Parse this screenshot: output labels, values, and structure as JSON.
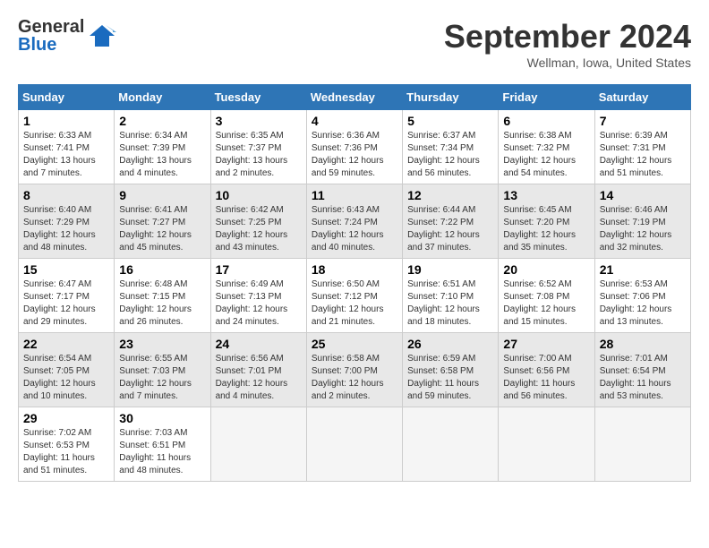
{
  "header": {
    "logo_line1": "General",
    "logo_line2": "Blue",
    "month": "September 2024",
    "location": "Wellman, Iowa, United States"
  },
  "columns": [
    "Sunday",
    "Monday",
    "Tuesday",
    "Wednesday",
    "Thursday",
    "Friday",
    "Saturday"
  ],
  "weeks": [
    [
      {
        "day": "1",
        "sunrise": "Sunrise: 6:33 AM",
        "sunset": "Sunset: 7:41 PM",
        "daylight": "Daylight: 13 hours and 7 minutes."
      },
      {
        "day": "2",
        "sunrise": "Sunrise: 6:34 AM",
        "sunset": "Sunset: 7:39 PM",
        "daylight": "Daylight: 13 hours and 4 minutes."
      },
      {
        "day": "3",
        "sunrise": "Sunrise: 6:35 AM",
        "sunset": "Sunset: 7:37 PM",
        "daylight": "Daylight: 13 hours and 2 minutes."
      },
      {
        "day": "4",
        "sunrise": "Sunrise: 6:36 AM",
        "sunset": "Sunset: 7:36 PM",
        "daylight": "Daylight: 12 hours and 59 minutes."
      },
      {
        "day": "5",
        "sunrise": "Sunrise: 6:37 AM",
        "sunset": "Sunset: 7:34 PM",
        "daylight": "Daylight: 12 hours and 56 minutes."
      },
      {
        "day": "6",
        "sunrise": "Sunrise: 6:38 AM",
        "sunset": "Sunset: 7:32 PM",
        "daylight": "Daylight: 12 hours and 54 minutes."
      },
      {
        "day": "7",
        "sunrise": "Sunrise: 6:39 AM",
        "sunset": "Sunset: 7:31 PM",
        "daylight": "Daylight: 12 hours and 51 minutes."
      }
    ],
    [
      {
        "day": "8",
        "sunrise": "Sunrise: 6:40 AM",
        "sunset": "Sunset: 7:29 PM",
        "daylight": "Daylight: 12 hours and 48 minutes."
      },
      {
        "day": "9",
        "sunrise": "Sunrise: 6:41 AM",
        "sunset": "Sunset: 7:27 PM",
        "daylight": "Daylight: 12 hours and 45 minutes."
      },
      {
        "day": "10",
        "sunrise": "Sunrise: 6:42 AM",
        "sunset": "Sunset: 7:25 PM",
        "daylight": "Daylight: 12 hours and 43 minutes."
      },
      {
        "day": "11",
        "sunrise": "Sunrise: 6:43 AM",
        "sunset": "Sunset: 7:24 PM",
        "daylight": "Daylight: 12 hours and 40 minutes."
      },
      {
        "day": "12",
        "sunrise": "Sunrise: 6:44 AM",
        "sunset": "Sunset: 7:22 PM",
        "daylight": "Daylight: 12 hours and 37 minutes."
      },
      {
        "day": "13",
        "sunrise": "Sunrise: 6:45 AM",
        "sunset": "Sunset: 7:20 PM",
        "daylight": "Daylight: 12 hours and 35 minutes."
      },
      {
        "day": "14",
        "sunrise": "Sunrise: 6:46 AM",
        "sunset": "Sunset: 7:19 PM",
        "daylight": "Daylight: 12 hours and 32 minutes."
      }
    ],
    [
      {
        "day": "15",
        "sunrise": "Sunrise: 6:47 AM",
        "sunset": "Sunset: 7:17 PM",
        "daylight": "Daylight: 12 hours and 29 minutes."
      },
      {
        "day": "16",
        "sunrise": "Sunrise: 6:48 AM",
        "sunset": "Sunset: 7:15 PM",
        "daylight": "Daylight: 12 hours and 26 minutes."
      },
      {
        "day": "17",
        "sunrise": "Sunrise: 6:49 AM",
        "sunset": "Sunset: 7:13 PM",
        "daylight": "Daylight: 12 hours and 24 minutes."
      },
      {
        "day": "18",
        "sunrise": "Sunrise: 6:50 AM",
        "sunset": "Sunset: 7:12 PM",
        "daylight": "Daylight: 12 hours and 21 minutes."
      },
      {
        "day": "19",
        "sunrise": "Sunrise: 6:51 AM",
        "sunset": "Sunset: 7:10 PM",
        "daylight": "Daylight: 12 hours and 18 minutes."
      },
      {
        "day": "20",
        "sunrise": "Sunrise: 6:52 AM",
        "sunset": "Sunset: 7:08 PM",
        "daylight": "Daylight: 12 hours and 15 minutes."
      },
      {
        "day": "21",
        "sunrise": "Sunrise: 6:53 AM",
        "sunset": "Sunset: 7:06 PM",
        "daylight": "Daylight: 12 hours and 13 minutes."
      }
    ],
    [
      {
        "day": "22",
        "sunrise": "Sunrise: 6:54 AM",
        "sunset": "Sunset: 7:05 PM",
        "daylight": "Daylight: 12 hours and 10 minutes."
      },
      {
        "day": "23",
        "sunrise": "Sunrise: 6:55 AM",
        "sunset": "Sunset: 7:03 PM",
        "daylight": "Daylight: 12 hours and 7 minutes."
      },
      {
        "day": "24",
        "sunrise": "Sunrise: 6:56 AM",
        "sunset": "Sunset: 7:01 PM",
        "daylight": "Daylight: 12 hours and 4 minutes."
      },
      {
        "day": "25",
        "sunrise": "Sunrise: 6:58 AM",
        "sunset": "Sunset: 7:00 PM",
        "daylight": "Daylight: 12 hours and 2 minutes."
      },
      {
        "day": "26",
        "sunrise": "Sunrise: 6:59 AM",
        "sunset": "Sunset: 6:58 PM",
        "daylight": "Daylight: 11 hours and 59 minutes."
      },
      {
        "day": "27",
        "sunrise": "Sunrise: 7:00 AM",
        "sunset": "Sunset: 6:56 PM",
        "daylight": "Daylight: 11 hours and 56 minutes."
      },
      {
        "day": "28",
        "sunrise": "Sunrise: 7:01 AM",
        "sunset": "Sunset: 6:54 PM",
        "daylight": "Daylight: 11 hours and 53 minutes."
      }
    ],
    [
      {
        "day": "29",
        "sunrise": "Sunrise: 7:02 AM",
        "sunset": "Sunset: 6:53 PM",
        "daylight": "Daylight: 11 hours and 51 minutes."
      },
      {
        "day": "30",
        "sunrise": "Sunrise: 7:03 AM",
        "sunset": "Sunset: 6:51 PM",
        "daylight": "Daylight: 11 hours and 48 minutes."
      },
      null,
      null,
      null,
      null,
      null
    ]
  ]
}
